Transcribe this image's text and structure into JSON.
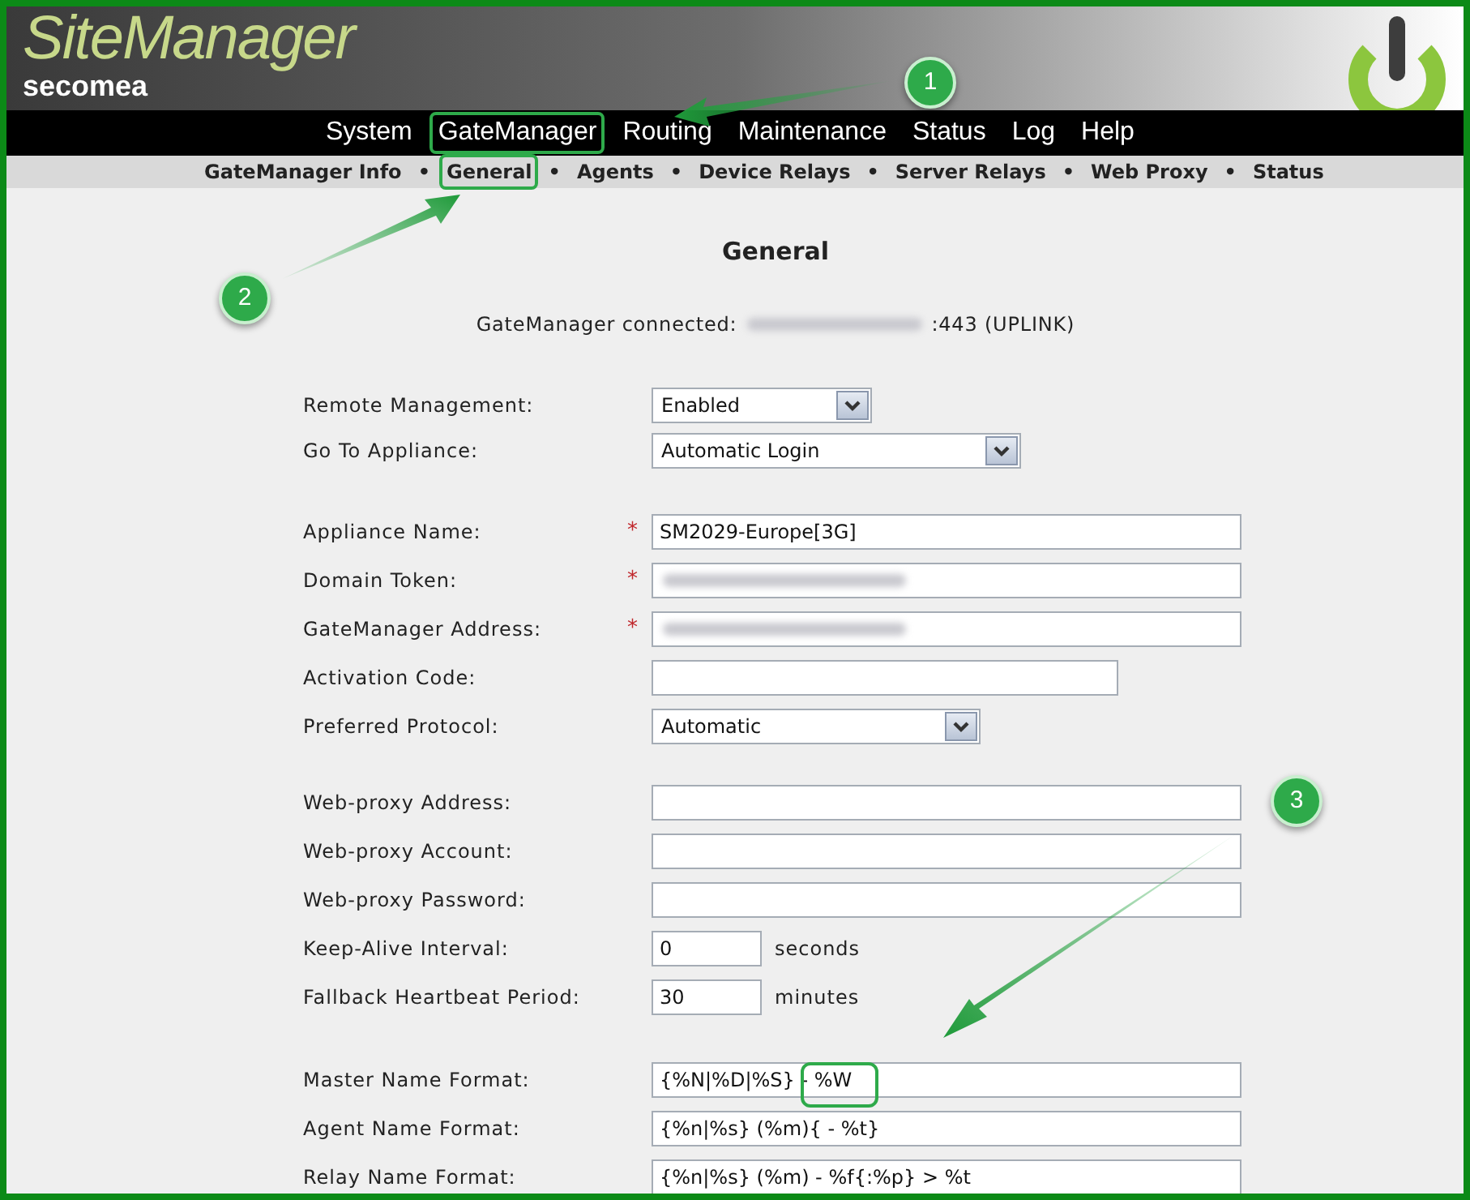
{
  "header": {
    "logo_title": "SiteManager",
    "logo_brand": "secomea"
  },
  "menu": [
    {
      "label": "System",
      "selected": false
    },
    {
      "label": "GateManager",
      "selected": true
    },
    {
      "label": "Routing",
      "selected": false
    },
    {
      "label": "Maintenance",
      "selected": false
    },
    {
      "label": "Status",
      "selected": false
    },
    {
      "label": "Log",
      "selected": false
    },
    {
      "label": "Help",
      "selected": false
    }
  ],
  "submenu": {
    "separator": "•",
    "items": [
      {
        "label": "GateManager Info",
        "selected": false
      },
      {
        "label": "General",
        "selected": true
      },
      {
        "label": "Agents",
        "selected": false
      },
      {
        "label": "Device Relays",
        "selected": false
      },
      {
        "label": "Server Relays",
        "selected": false
      },
      {
        "label": "Web Proxy",
        "selected": false
      },
      {
        "label": "Status",
        "selected": false
      }
    ]
  },
  "page_title": "General",
  "connection": {
    "label": "GateManager connected:",
    "suffix": ":443 (UPLINK)"
  },
  "groups": [
    {
      "rows": [
        {
          "label": "Remote Management:",
          "kind": "select",
          "value": "Enabled"
        },
        {
          "label": "Go To Appliance:",
          "kind": "select",
          "value": "Automatic Login"
        }
      ]
    },
    {
      "rows": [
        {
          "label": "Appliance Name:",
          "kind": "text",
          "value": "SM2029-Europe[3G]",
          "required": "*"
        },
        {
          "label": "Domain Token:",
          "kind": "blurred",
          "required": "*"
        },
        {
          "label": "GateManager Address:",
          "kind": "blurred",
          "required": "*"
        },
        {
          "label": "Activation Code:",
          "kind": "text",
          "value": ""
        },
        {
          "label": "Preferred Protocol:",
          "kind": "select",
          "value": "Automatic"
        }
      ]
    },
    {
      "rows": [
        {
          "label": "Web-proxy Address:",
          "kind": "text",
          "value": ""
        },
        {
          "label": "Web-proxy Account:",
          "kind": "text",
          "value": ""
        },
        {
          "label": "Web-proxy Password:",
          "kind": "text",
          "value": ""
        },
        {
          "label": "Keep-Alive Interval:",
          "kind": "text",
          "value": "0",
          "unit": "seconds"
        },
        {
          "label": "Fallback Heartbeat Period:",
          "kind": "text",
          "value": "30",
          "unit": "minutes"
        }
      ]
    },
    {
      "rows": [
        {
          "label": "Master Name Format:",
          "kind": "text",
          "value": "{%N|%D|%S} - %W"
        },
        {
          "label": "Agent Name Format:",
          "kind": "text",
          "value": "{%n|%s} (%m){ - %t}"
        },
        {
          "label": "Relay Name Format:",
          "kind": "text",
          "value": "{%n|%s} (%m) - %f{:%p} > %t"
        }
      ]
    }
  ],
  "callouts": [
    {
      "label": "1"
    },
    {
      "label": "2"
    },
    {
      "label": "3"
    }
  ]
}
